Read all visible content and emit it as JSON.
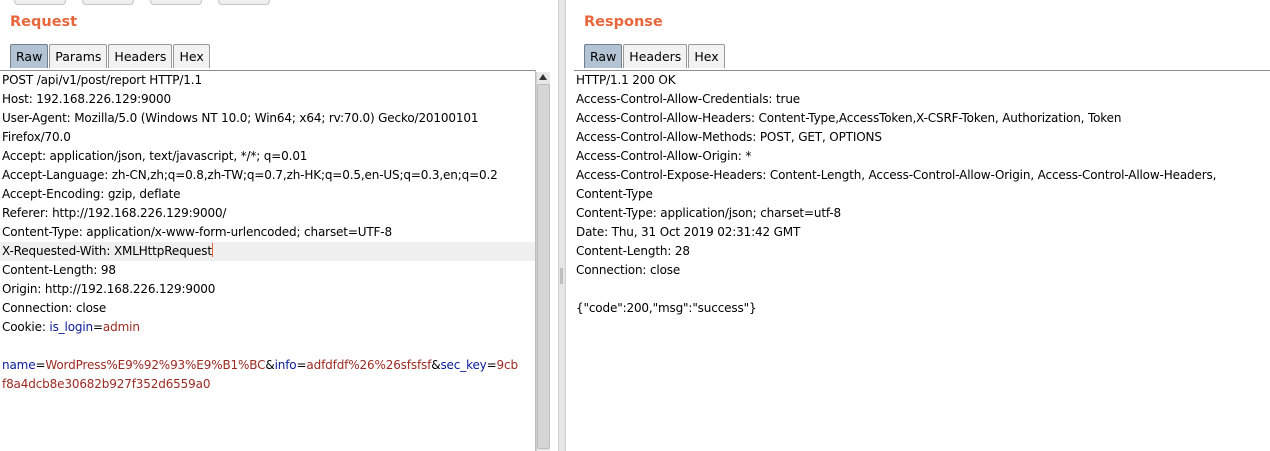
{
  "request": {
    "title": "Request",
    "tabs": [
      "Raw",
      "Params",
      "Headers",
      "Hex"
    ],
    "active_tab": "Raw",
    "lines": [
      "POST /api/v1/post/report HTTP/1.1",
      "Host: 192.168.226.129:9000",
      "User-Agent: Mozilla/5.0 (Windows NT 10.0; Win64; x64; rv:70.0) Gecko/20100101",
      "Firefox/70.0",
      "Accept: application/json, text/javascript, */*; q=0.01",
      "Accept-Language: zh-CN,zh;q=0.8,zh-TW;q=0.7,zh-HK;q=0.5,en-US;q=0.3,en;q=0.2",
      "Accept-Encoding: gzip, deflate",
      "Referer: http://192.168.226.129:9000/",
      "Content-Type: application/x-www-form-urlencoded; charset=UTF-8",
      "X-Requested-With: XMLHttpRequest",
      "Content-Length: 98",
      "Origin: http://192.168.226.129:9000",
      "Connection: close"
    ],
    "cookie_prefix": "Cookie: ",
    "cookie_name": "is_login",
    "cookie_eq": "=",
    "cookie_value": "admin",
    "body": {
      "p1_name": "name",
      "p1_eq": "=",
      "p1_value": "WordPress%E9%92%93%E9%B1%BC",
      "amp1": "&",
      "p2_name": "info",
      "p2_eq": "=",
      "p2_value": "adfdfdf%26%26sfsfsf",
      "amp2": "&",
      "p3_name": "sec_key",
      "p3_eq": "=",
      "p3_value_a": "9cb",
      "p3_value_b": "f8a4dcb8e30682b927f352d6559a0"
    }
  },
  "response": {
    "title": "Response",
    "tabs": [
      "Raw",
      "Headers",
      "Hex"
    ],
    "active_tab": "Raw",
    "lines": [
      "HTTP/1.1 200 OK",
      "Access-Control-Allow-Credentials: true",
      "Access-Control-Allow-Headers: Content-Type,AccessToken,X-CSRF-Token, Authorization, Token",
      "Access-Control-Allow-Methods: POST, GET, OPTIONS",
      "Access-Control-Allow-Origin: *",
      "Access-Control-Expose-Headers: Content-Length, Access-Control-Allow-Origin, Access-Control-Allow-Headers,",
      "Content-Type",
      "Content-Type: application/json; charset=utf-8",
      "Date: Thu, 31 Oct 2019 02:31:42 GMT",
      "Content-Length: 28",
      "Connection: close",
      "",
      "{\"code\":200,\"msg\":\"success\"}"
    ]
  }
}
